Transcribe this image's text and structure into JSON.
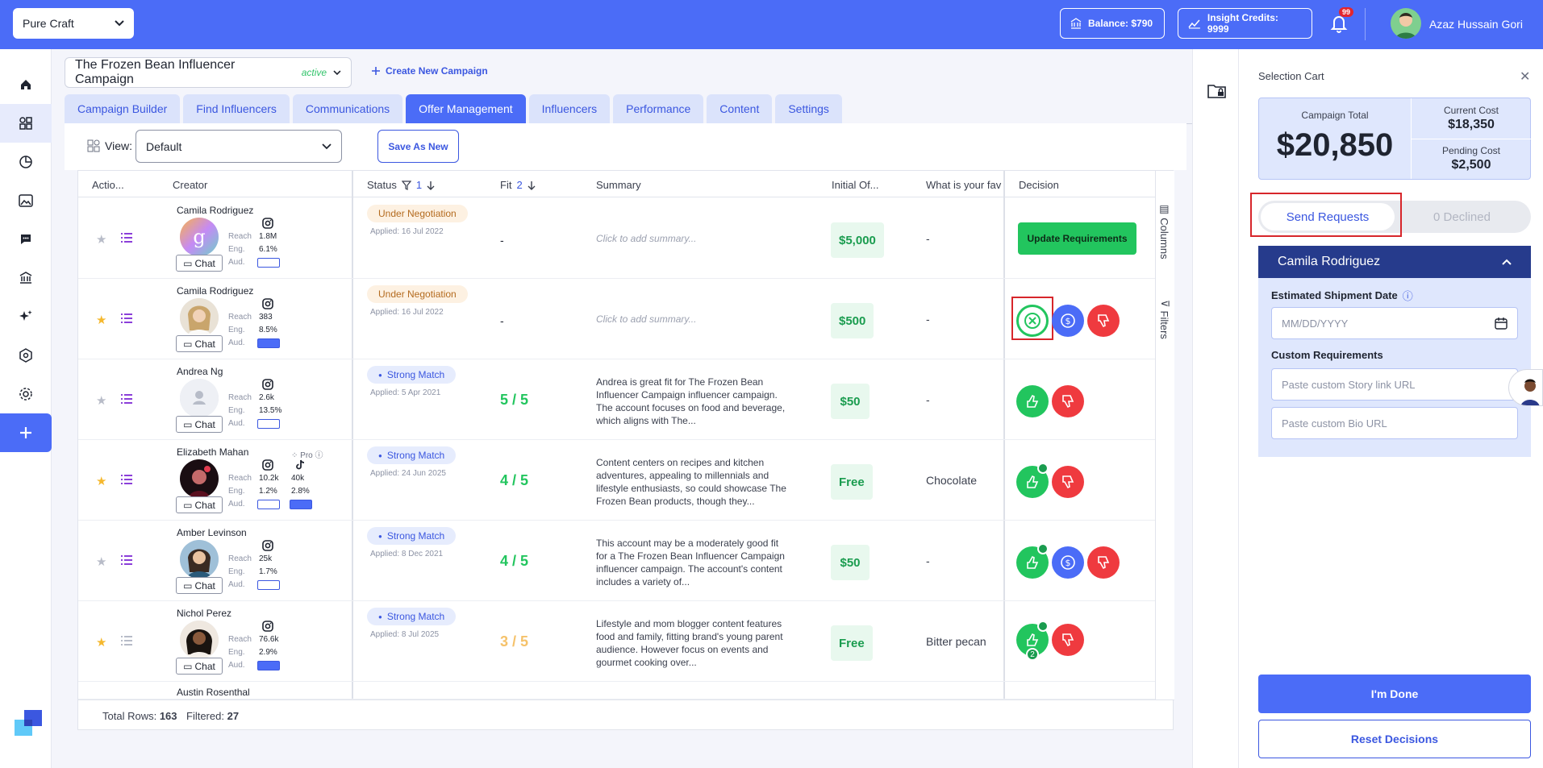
{
  "topbar": {
    "workspace": "Pure Craft",
    "balance": "Balance: $790",
    "insight_credits": "Insight Credits: 9999",
    "notifications": "99",
    "user_name": "Azaz Hussain Gori"
  },
  "campaign": {
    "title": "The Frozen Bean Influencer Campaign",
    "status": "active",
    "create_new": "Create New Campaign"
  },
  "tabs": [
    "Campaign Builder",
    "Find Influencers",
    "Communications",
    "Offer Management",
    "Influencers",
    "Performance",
    "Content",
    "Settings"
  ],
  "toolbar": {
    "view_label": "View:",
    "view_value": "Default",
    "save_as_new": "Save As New"
  },
  "columns": {
    "actions": "Actio...",
    "creator": "Creator",
    "status": "Status",
    "status_sort": "1",
    "fit": "Fit",
    "fit_sort": "2",
    "summary": "Summary",
    "initial_offer": "Initial Of...",
    "question": "What is your fav",
    "decision": "Decision"
  },
  "labels": {
    "reach": "Reach",
    "eng": "Eng.",
    "aud": "Aud.",
    "chat": "Chat",
    "pro": "Pro",
    "update_requirements": "Update Requirements",
    "columns_side": "Columns",
    "filters_side": "Filters"
  },
  "rows": [
    {
      "name": "Camila Rodriguez",
      "reach": "1.8M",
      "eng": "6.1%",
      "status": "Under Negotiation",
      "applied": "Applied: 16 Jul 2022",
      "fit": "-",
      "summary": "Click to add summary...",
      "offer": "$5,000",
      "answer": "-"
    },
    {
      "name": "Camila Rodriguez",
      "reach": "383",
      "eng": "8.5%",
      "status": "Under Negotiation",
      "applied": "Applied: 16 Jul 2022",
      "fit": "-",
      "summary": "Click to add summary...",
      "offer": "$500",
      "answer": "-"
    },
    {
      "name": "Andrea Ng",
      "reach": "2.6k",
      "eng": "13.5%",
      "status": "Strong Match",
      "applied": "Applied: 5 Apr 2021",
      "fit": "5 / 5",
      "summary": "Andrea is great fit for The Frozen Bean Influencer Campaign influencer campaign. The account focuses on food and beverage, which aligns with The...",
      "offer": "$50",
      "answer": "-"
    },
    {
      "name": "Elizabeth Mahan",
      "reach": "10.2k",
      "eng": "1.2%",
      "reach2": "40k",
      "eng2": "2.8%",
      "status": "Strong Match",
      "applied": "Applied: 24 Jun 2025",
      "fit": "4 / 5",
      "summary": "Content centers on recipes and kitchen adventures, appealing to millennials and lifestyle enthusiasts, so could showcase The Frozen Bean products, though they...",
      "offer": "Free",
      "answer": "Chocolate"
    },
    {
      "name": "Amber Levinson",
      "reach": "25k",
      "eng": "1.7%",
      "status": "Strong Match",
      "applied": "Applied: 8 Dec 2021",
      "fit": "4 / 5",
      "summary": "This account may be a moderately good fit for a The Frozen Bean Influencer Campaign influencer campaign. The account's content includes a variety of...",
      "offer": "$50",
      "answer": "-"
    },
    {
      "name": "Nichol Perez",
      "reach": "76.6k",
      "eng": "2.9%",
      "status": "Strong Match",
      "applied": "Applied: 8 Jul 2025",
      "fit": "3 / 5",
      "summary": "Lifestyle and mom blogger content features food and family, fitting brand's young parent audience. However focus on events and gourmet cooking over...",
      "offer": "Free",
      "answer": "Bitter pecan",
      "approve_count": "2"
    },
    {
      "name": "Austin Rosenthal"
    }
  ],
  "footer": {
    "total_label": "Total Rows:",
    "total": "163",
    "filtered_label": "Filtered:",
    "filtered": "27"
  },
  "cart": {
    "title": "Selection Cart",
    "campaign_total_label": "Campaign Total",
    "campaign_total": "$20,850",
    "current_cost_label": "Current Cost",
    "current_cost": "$18,350",
    "pending_cost_label": "Pending Cost",
    "pending_cost": "$2,500",
    "send_requests": "Send Requests",
    "declined": "0 Declined",
    "creator": "Camila Rodriguez",
    "ship_label": "Estimated Shipment Date",
    "date_placeholder": "MM/DD/YYYY",
    "custom_req_label": "Custom Requirements",
    "story_placeholder": "Paste custom Story link URL",
    "bio_placeholder": "Paste custom Bio URL",
    "done": "I'm Done",
    "reset": "Reset Decisions"
  },
  "colors": {
    "brand": "#4b6cf7",
    "approve": "#22c55e",
    "decline": "#ef3a3f",
    "fit_high": "#22c55e",
    "fit_mid": "#f5c26b"
  }
}
